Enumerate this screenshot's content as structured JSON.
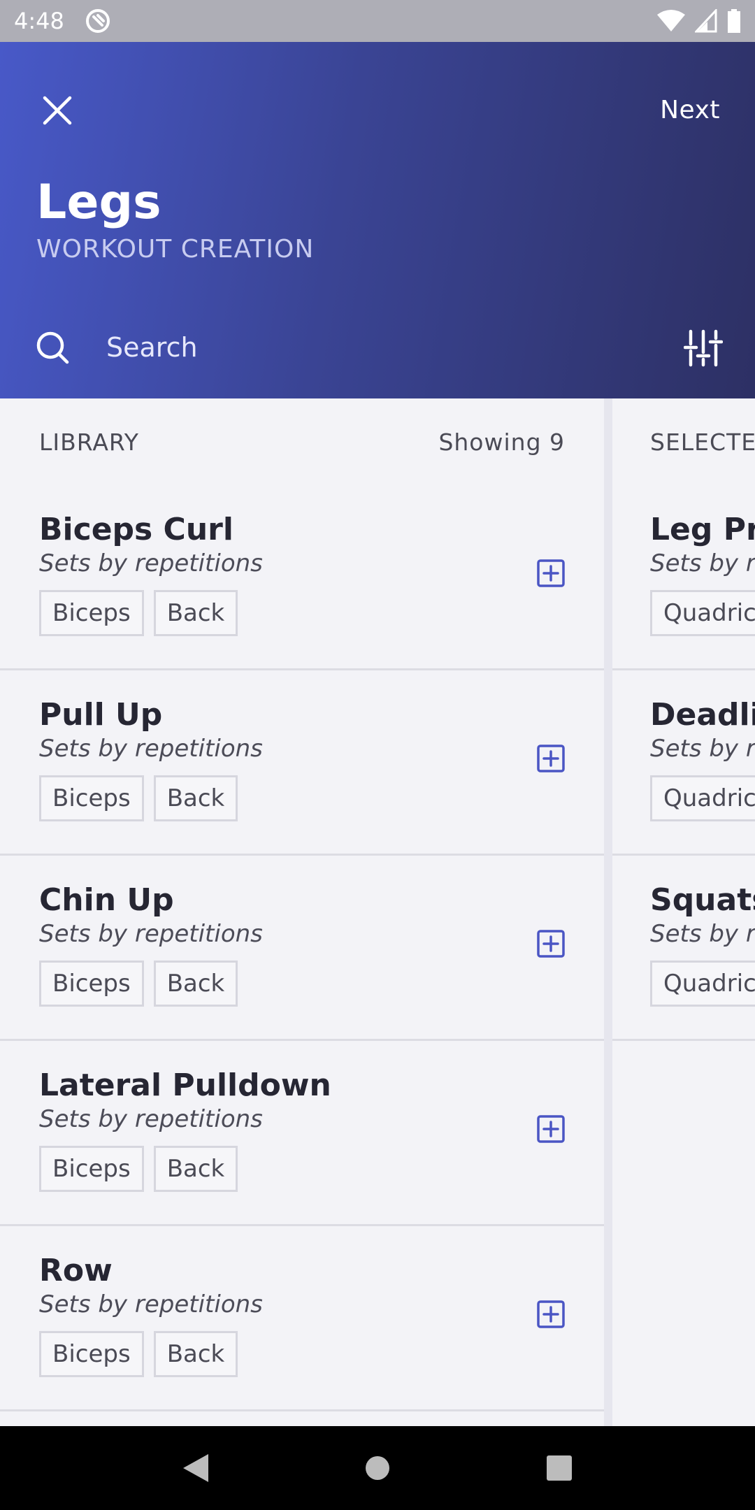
{
  "status": {
    "time": "4:48"
  },
  "header": {
    "next_label": "Next",
    "title": "Legs",
    "subtitle": "WORKOUT CREATION",
    "search_placeholder": "Search"
  },
  "library": {
    "heading": "LIBRARY",
    "count": "Showing 9",
    "items": [
      {
        "name": "Biceps Curl",
        "sub": "Sets by repetitions",
        "tags": [
          "Biceps",
          "Back"
        ]
      },
      {
        "name": "Pull Up",
        "sub": "Sets by repetitions",
        "tags": [
          "Biceps",
          "Back"
        ]
      },
      {
        "name": "Chin Up",
        "sub": "Sets by repetitions",
        "tags": [
          "Biceps",
          "Back"
        ]
      },
      {
        "name": "Lateral Pulldown",
        "sub": "Sets by repetitions",
        "tags": [
          "Biceps",
          "Back"
        ]
      },
      {
        "name": "Row",
        "sub": "Sets by repetitions",
        "tags": [
          "Biceps",
          "Back"
        ]
      }
    ]
  },
  "selected": {
    "heading": "SELECTE",
    "items": [
      {
        "name": "Leg Pre",
        "sub": "Sets by r",
        "tag": "Quadrice"
      },
      {
        "name": "Deadlif",
        "sub": "Sets by r",
        "tag": "Quadrice"
      },
      {
        "name": "Squats",
        "sub": "Sets by r",
        "tag": "Quadrice"
      }
    ]
  },
  "colors": {
    "accent": "#4a55c4",
    "header_start": "#4859c8",
    "header_end": "#2d3064"
  },
  "icons": {
    "close": "close-icon",
    "search": "search-icon",
    "filter": "sliders-icon",
    "add": "plus-square-icon",
    "back": "back-triangle-icon",
    "home": "home-circle-icon",
    "recents": "recents-square-icon"
  }
}
